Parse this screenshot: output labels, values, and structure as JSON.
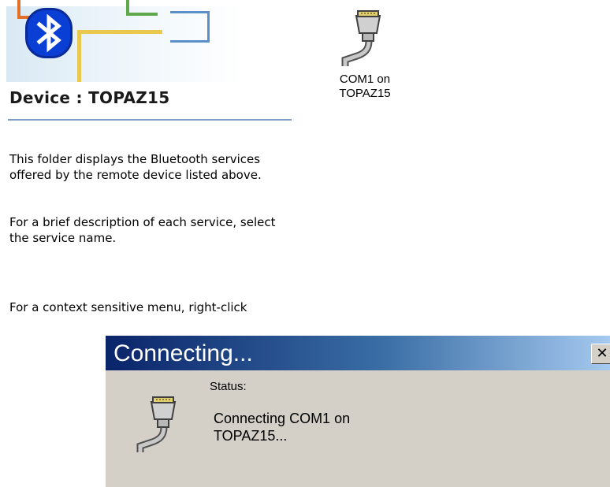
{
  "header": {
    "title": "Device : TOPAZ15",
    "logo_icon": "bluetooth-icon"
  },
  "description": {
    "paragraphs": [
      "This folder displays the Bluetooth services offered by the remote device listed above.",
      "For a brief description of each service, select the service name.",
      "For a context sensitive menu, right-click"
    ]
  },
  "services": [
    {
      "icon": "serial-port-icon",
      "label_lines": [
        "COM1 on",
        "TOPAZ15"
      ]
    }
  ],
  "dialog": {
    "title": "Connecting...",
    "close_label": "✕",
    "icon": "serial-port-icon",
    "status_label": "Status:",
    "status_lines": [
      "Connecting COM1 on",
      "TOPAZ15..."
    ]
  },
  "colors": {
    "bluetooth_blue": "#0a3fd6",
    "titlebar_start": "#0a246a",
    "titlebar_end": "#a6caf0",
    "dialog_bg": "#d4d0c8"
  }
}
